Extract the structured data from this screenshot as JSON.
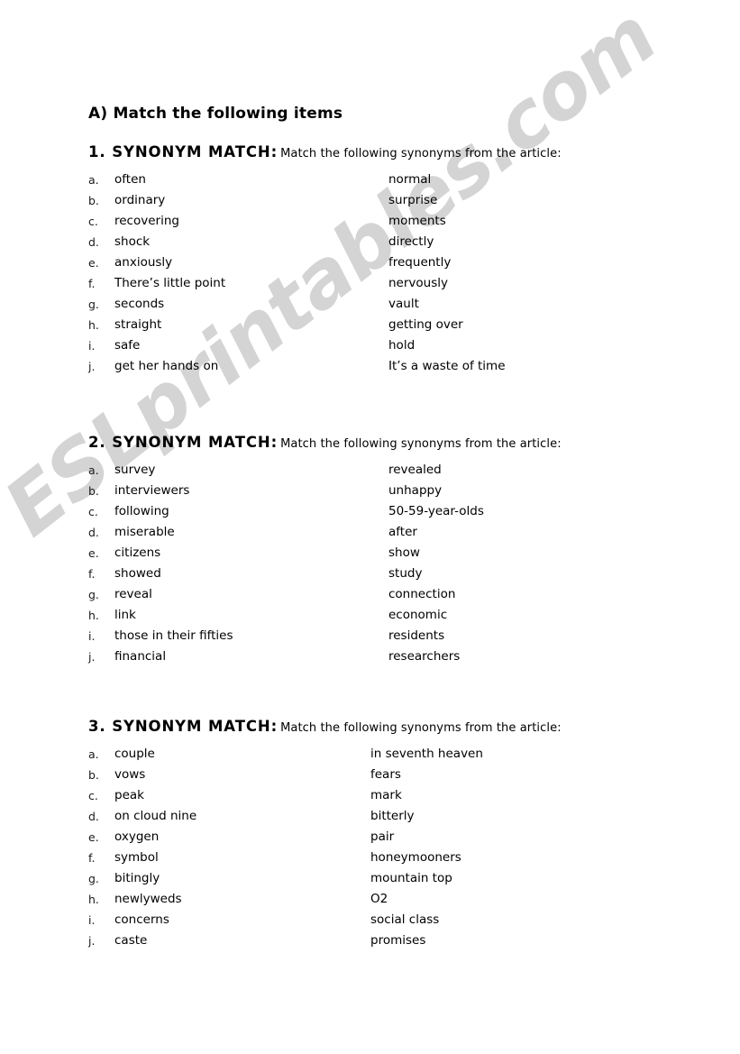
{
  "document": {
    "title": "A) Match the following items",
    "watermark": "ESLprintables.com",
    "watermark_color": "#d4d4d4",
    "background_color": "#ffffff",
    "text_color": "#000000"
  },
  "sections": [
    {
      "number": "1.",
      "heading_strong": "1. SYNONYM MATCH:",
      "heading_rest": "Match the following synonyms from the article:",
      "rows": [
        {
          "letter": "a.",
          "left": "often",
          "right": "normal"
        },
        {
          "letter": "b.",
          "left": "ordinary",
          "right": "surprise"
        },
        {
          "letter": "c.",
          "left": "recovering",
          "right": "moments"
        },
        {
          "letter": "d.",
          "left": "shock",
          "right": "directly"
        },
        {
          "letter": "e.",
          "left": "anxiously",
          "right": "frequently"
        },
        {
          "letter": "f.",
          "left": "There’s little point",
          "right": "nervously"
        },
        {
          "letter": "g.",
          "left": "seconds",
          "right": "vault"
        },
        {
          "letter": "h.",
          "left": "straight",
          "right": "getting over"
        },
        {
          "letter": "i.",
          "left": "safe",
          "right": "hold"
        },
        {
          "letter": "j.",
          "left": "get her hands on",
          "right": "It’s a waste of time"
        }
      ]
    },
    {
      "number": "2.",
      "heading_strong": "2. SYNONYM MATCH:",
      "heading_rest": "Match the following synonyms from the article:",
      "rows": [
        {
          "letter": "a.",
          "left": "survey",
          "right": "revealed"
        },
        {
          "letter": "b.",
          "left": "interviewers",
          "right": "unhappy"
        },
        {
          "letter": "c.",
          "left": "following",
          "right": "50-59-year-olds"
        },
        {
          "letter": "d.",
          "left": "miserable",
          "right": "after"
        },
        {
          "letter": "e.",
          "left": "citizens",
          "right": "show"
        },
        {
          "letter": "f.",
          "left": "showed",
          "right": "study"
        },
        {
          "letter": "g.",
          "left": "reveal",
          "right": "connection"
        },
        {
          "letter": "h.",
          "left": "link",
          "right": "economic"
        },
        {
          "letter": "i.",
          "left": "those in their fifties",
          "right": "residents"
        },
        {
          "letter": "j.",
          "left": "financial",
          "right": "researchers"
        }
      ]
    },
    {
      "number": "3.",
      "heading_strong": "3. SYNONYM MATCH:",
      "heading_rest": "Match the following synonyms from the article:",
      "rows": [
        {
          "letter": "a.",
          "left": "couple",
          "right": "in seventh heaven"
        },
        {
          "letter": "b.",
          "left": "vows",
          "right": "fears"
        },
        {
          "letter": "c.",
          "left": "peak",
          "right": "mark"
        },
        {
          "letter": "d.",
          "left": "on cloud nine",
          "right": "bitterly"
        },
        {
          "letter": "e.",
          "left": "oxygen",
          "right": "pair"
        },
        {
          "letter": "f.",
          "left": "symbol",
          "right": "honeymooners"
        },
        {
          "letter": "g.",
          "left": "bitingly",
          "right": "mountain top"
        },
        {
          "letter": "h.",
          "left": "newlyweds",
          "right": "O2"
        },
        {
          "letter": "i.",
          "left": "concerns",
          "right": "social class"
        },
        {
          "letter": "j.",
          "left": "caste",
          "right": "promises"
        }
      ]
    }
  ]
}
